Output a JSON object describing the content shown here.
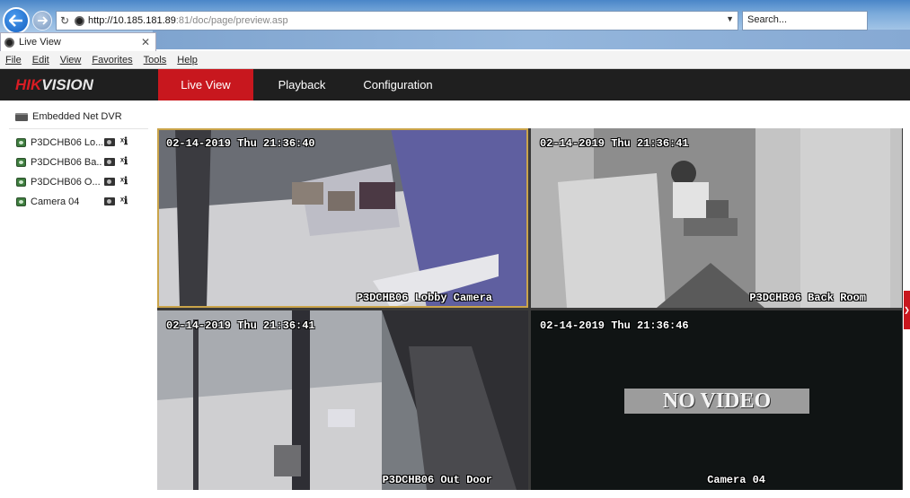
{
  "browser": {
    "url_host": "http://10.185.181.89",
    "url_path": ":81/doc/page/preview.asp",
    "search_placeholder": "Search...",
    "tab_title": "Live View",
    "menu": [
      "File",
      "Edit",
      "View",
      "Favorites",
      "Tools",
      "Help"
    ]
  },
  "header": {
    "logo_red": "HIK",
    "logo_white": "VISION",
    "tabs": [
      "Live View",
      "Playback",
      "Configuration"
    ],
    "active_tab": "Live View",
    "accent_color": "#c8171e"
  },
  "sidebar": {
    "device_label": "Embedded Net DVR",
    "cameras": [
      {
        "label": "P3DCHB06 Lo..."
      },
      {
        "label": "P3DCHB06 Ba..."
      },
      {
        "label": "P3DCHB06 O..."
      },
      {
        "label": "Camera 04"
      }
    ]
  },
  "tiles": [
    {
      "timestamp": "02-14-2019 Thu 21:36:40",
      "camera_name": "P3DCHB06 Lobby Camera",
      "no_video": false,
      "selected": true
    },
    {
      "timestamp": "02-14-2019 Thu 21:36:41",
      "camera_name": "P3DCHB06 Back Room",
      "no_video": false,
      "selected": false
    },
    {
      "timestamp": "02-14-2019 Thu 21:36:41",
      "camera_name": "P3DCHB06 Out Door",
      "no_video": false,
      "selected": false
    },
    {
      "timestamp": "02-14-2019 Thu 21:36:46",
      "camera_name": "Camera 04",
      "no_video": true,
      "no_video_text": "NO VIDEO",
      "selected": false
    }
  ]
}
